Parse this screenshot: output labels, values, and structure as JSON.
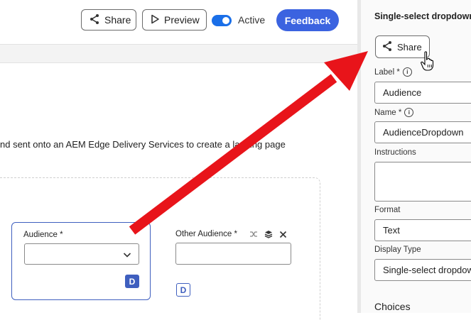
{
  "topbar": {
    "share_label": "Share",
    "preview_label": "Preview",
    "active_label": "Active",
    "feedback_label": "Feedback",
    "active_on": true
  },
  "canvas": {
    "description": "nd sent onto an AEM Edge Delivery Services to create a landing page",
    "audience_field": {
      "label": "Audience *",
      "value": "",
      "badge": "D"
    },
    "other_audience_field": {
      "label": "Other Audience *",
      "value": "",
      "badge": "D"
    }
  },
  "panel": {
    "title": "Single-select dropdown",
    "share_label": "Share",
    "label_field": {
      "label": "Label *",
      "value": "Audience"
    },
    "name_field": {
      "label": "Name *",
      "value": "AudienceDropdown"
    },
    "instructions_field": {
      "label": "Instructions",
      "value": ""
    },
    "format_field": {
      "label": "Format",
      "value": "Text"
    },
    "display_type_field": {
      "label": "Display Type",
      "value": "Single-select dropdown"
    },
    "choices_heading": "Choices"
  },
  "colors": {
    "accent_blue": "#3b63e0",
    "toggle_blue": "#1a6fe8",
    "card_border": "#3f5fbf",
    "annotation_arrow": "#e8141a"
  },
  "icons": [
    "share-icon",
    "play-icon",
    "chevron-down-icon",
    "shuffle-icon",
    "layers-icon",
    "close-icon",
    "info-icon",
    "hand-cursor-icon"
  ]
}
